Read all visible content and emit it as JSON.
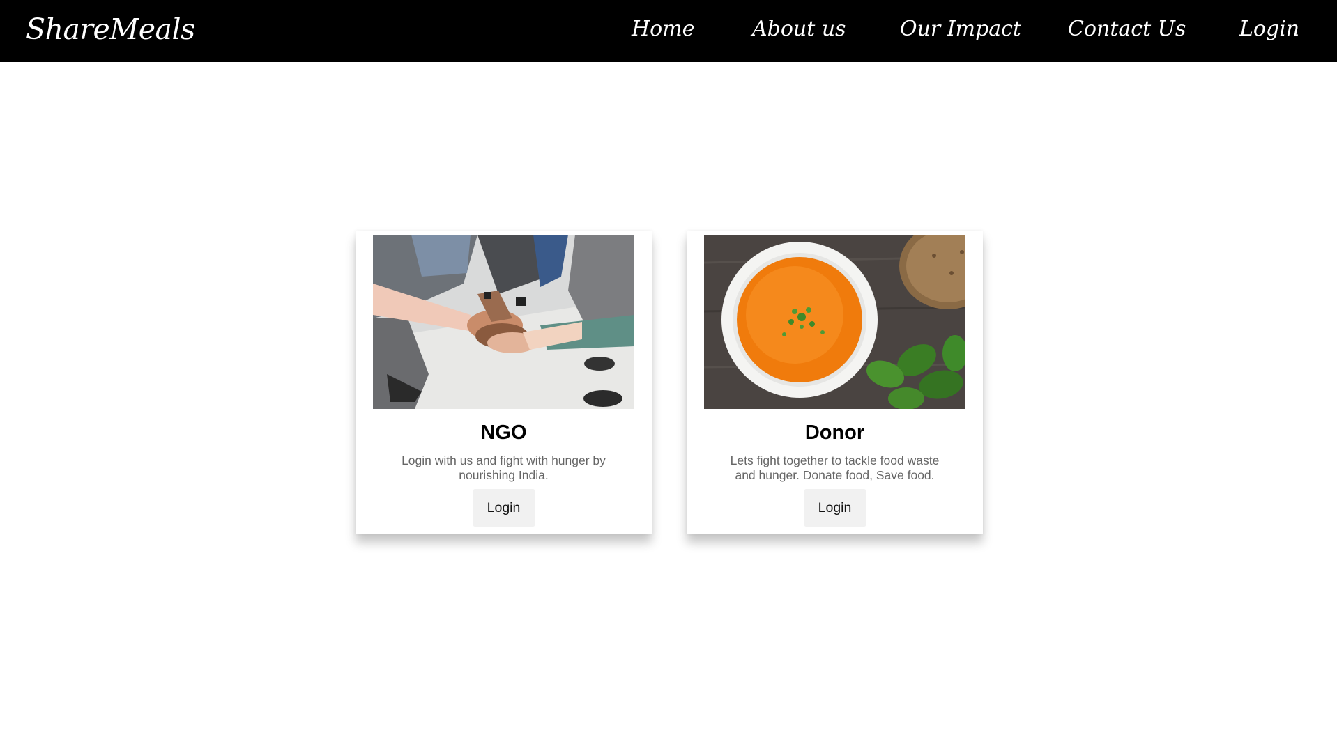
{
  "navbar": {
    "brand": "ShareMeals",
    "links": [
      "Home",
      "About us",
      "Our Impact",
      "Contact Us",
      "Login"
    ],
    "background": "#000000",
    "text_color": "#ffffff"
  },
  "cards": [
    {
      "title": "NGO",
      "description": "Login with us and fight with hunger by nourishing India.",
      "button_label": "Login",
      "image": "team-hands-photo"
    },
    {
      "title": "Donor",
      "description": "Lets fight together to tackle food waste and hunger. Donate food, Save food.",
      "button_label": "Login",
      "image": "tomato-soup-bowl-photo"
    }
  ],
  "colors": {
    "soup": "#f07b0c",
    "basil": "#3f8a2a",
    "button_bg": "#f1f1f1",
    "description": "#666666"
  }
}
